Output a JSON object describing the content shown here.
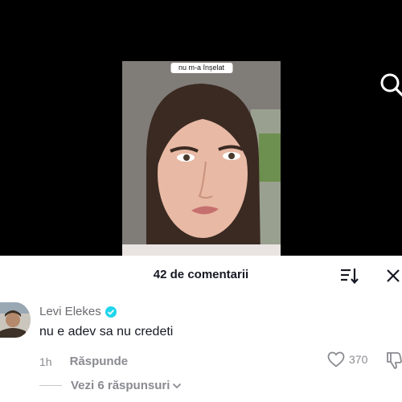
{
  "video": {
    "caption": "nu m-a înșelat"
  },
  "icons": {
    "search": "search-icon",
    "sort": "sort-icon",
    "close": "close-icon",
    "verified": "verified-badge-icon",
    "like": "heart-outline-icon",
    "dislike": "thumbs-down-icon",
    "chevron": "chevron-down-icon"
  },
  "colors": {
    "verified": "#20D5EC",
    "muted": "#8A8B91",
    "text": "#161823"
  },
  "comments_sheet": {
    "title": "42 de comentarii",
    "comment": {
      "author": "Levi Elekes",
      "text": "nu e adev sa nu credeti",
      "time": "1h",
      "reply_label": "Răspunde",
      "likes": "370",
      "view_replies_label": "Vezi 6 răspunsuri"
    }
  }
}
